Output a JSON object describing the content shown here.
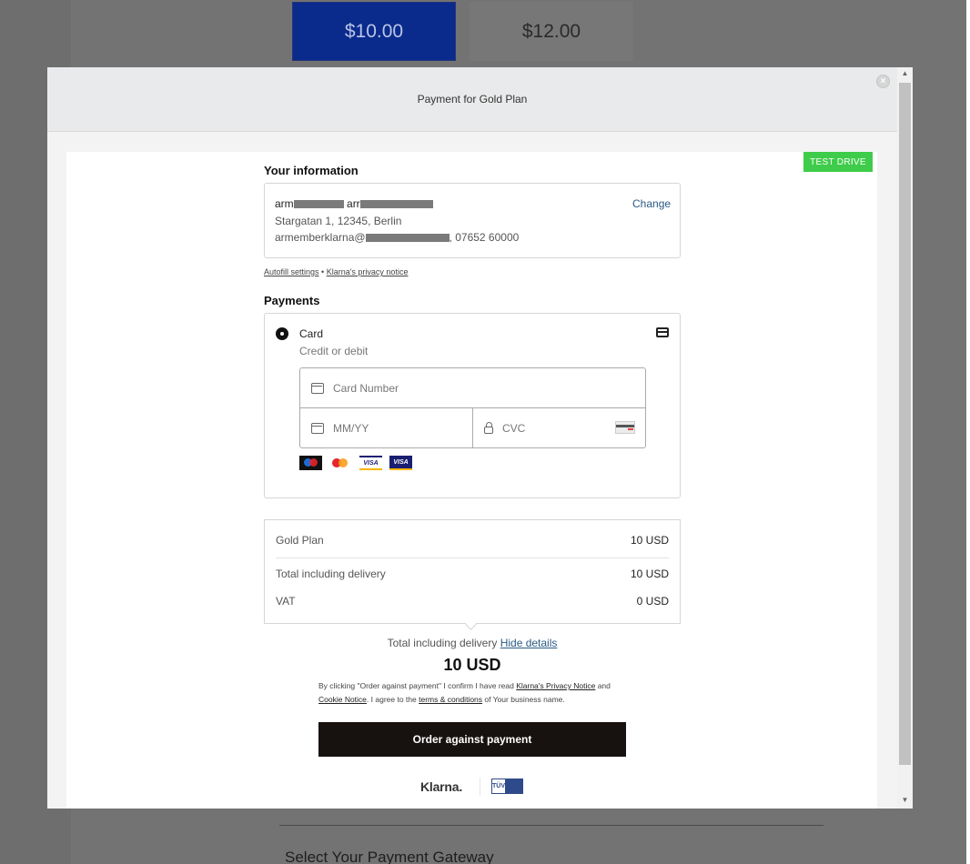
{
  "background": {
    "amount_options": [
      "$10.00",
      "$12.00"
    ],
    "section_heading": "Select Your Payment Gateway"
  },
  "modal": {
    "title": "Payment for Gold Plan",
    "close_label": "×",
    "badge": "TEST DRIVE"
  },
  "your_information": {
    "heading": "Your information",
    "name_first": "arm",
    "name_second": "arr",
    "address": "Stargatan 1, 12345, Berlin",
    "email_prefix": "armemberklarna@",
    "phone": ", 07652 60000",
    "change_label": "Change",
    "autofill_link": "Autofill settings",
    "separator": " • ",
    "privacy_link": "Klarna's privacy notice"
  },
  "payments": {
    "heading": "Payments",
    "method_title": "Card",
    "method_subtitle": "Credit or debit",
    "card_number_placeholder": "Card Number",
    "expiry_placeholder": "MM/YY",
    "cvc_placeholder": "CVC",
    "card_brands": [
      "maestro",
      "mastercard",
      "VISA",
      "VISA"
    ]
  },
  "summary": {
    "items": [
      {
        "label": "Gold Plan",
        "value": "10 USD"
      },
      {
        "label": "Total including delivery",
        "value": "10 USD"
      },
      {
        "label": "VAT",
        "value": "0 USD"
      }
    ],
    "total_label": "Total including delivery",
    "hide_details": "Hide details",
    "total_amount": "10 USD"
  },
  "legal": {
    "part1": "By clicking \"Order against payment\" I confirm I have read ",
    "privacy_notice": "Klarna's Privacy Notice",
    "part2": " and ",
    "cookie_notice": "Cookie Notice",
    "part3": ". I agree to the ",
    "terms": "terms & conditions",
    "part4": " of Your business name."
  },
  "order_button": "Order against payment",
  "footer": {
    "klarna": "Klarna.",
    "tuv": "TÜV"
  },
  "colors": {
    "accent_link": "#2a5a85",
    "test_drive_badge": "#3fcc4a",
    "order_button": "#17120f",
    "selected_amount": "#0a2a8c"
  }
}
